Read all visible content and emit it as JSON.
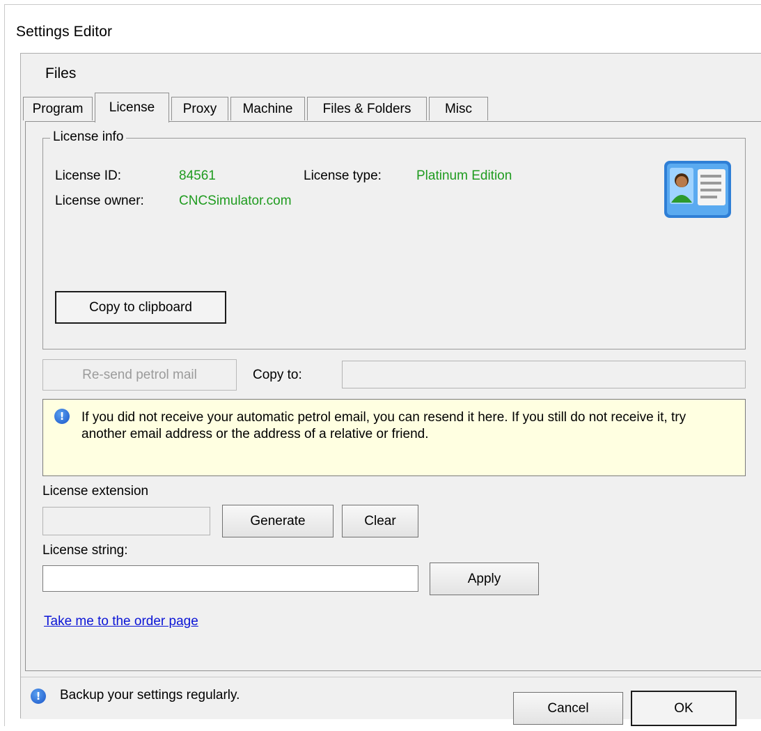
{
  "window": {
    "title": "Settings Editor"
  },
  "menu": {
    "files": "Files"
  },
  "tabs": [
    "Program",
    "License",
    "Proxy",
    "Machine",
    "Files & Folders",
    "Misc"
  ],
  "active_tab": "License",
  "license_info": {
    "group_title": "License info",
    "id_label": "License ID:",
    "id_value": "84561",
    "type_label": "License type:",
    "type_value": "Platinum Edition",
    "owner_label": "License owner:",
    "owner_value": "CNCSimulator.com",
    "copy_button": "Copy to clipboard",
    "icon": "license-card-icon"
  },
  "petrol": {
    "resend_button": "Re-send petrol mail",
    "copy_to_label": "Copy to:",
    "copy_to_value": ""
  },
  "notice": {
    "text": "If you did not receive your automatic petrol email, you can resend it here. If you still do not receive it, try another email address or the address of a relative or friend."
  },
  "extension": {
    "label": "License extension",
    "value": "",
    "generate_button": "Generate",
    "clear_button": "Clear"
  },
  "license_string": {
    "label": "License string:",
    "value": "",
    "apply_button": "Apply"
  },
  "order_link": "Take me to the order page",
  "status": {
    "message": "Backup your settings regularly."
  },
  "footer": {
    "cancel": "Cancel",
    "ok": "OK"
  },
  "colors": {
    "value_green": "#1f9b1f",
    "notice_bg": "#ffffe1",
    "link_blue": "#0a14d6",
    "panel_bg": "#f0f0f0"
  }
}
